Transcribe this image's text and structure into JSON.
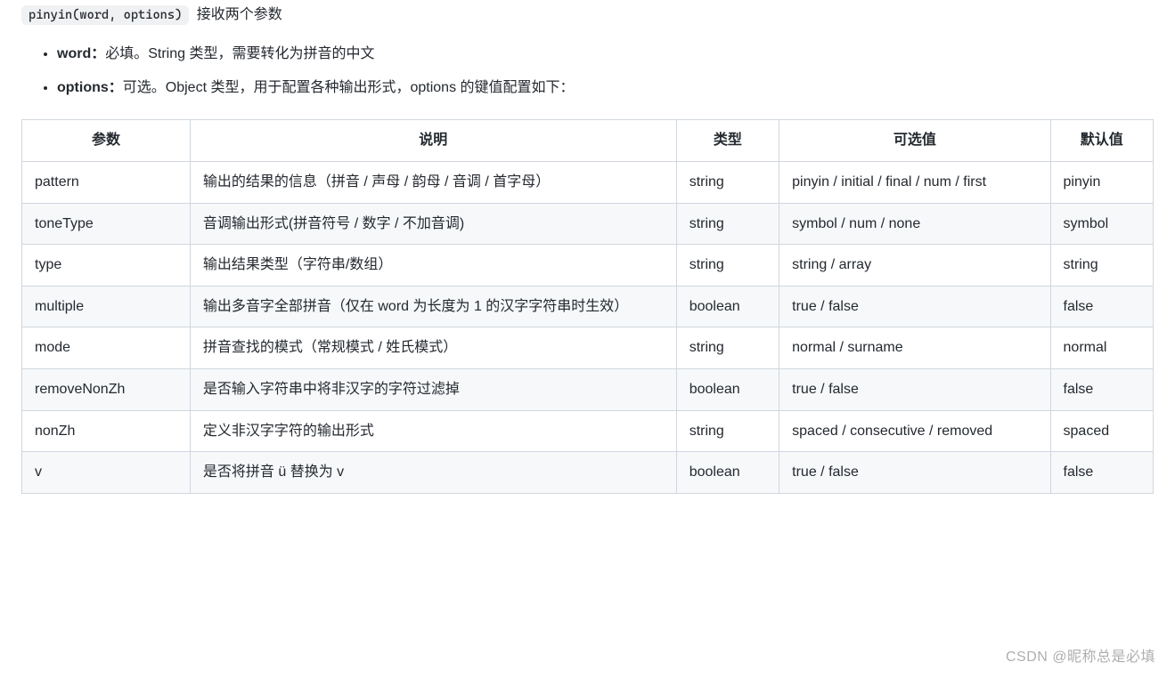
{
  "intro": {
    "code": "pinyin(word, options)",
    "label": "接收两个参数"
  },
  "args": [
    {
      "name": "word：",
      "desc": "必填。String 类型，需要转化为拼音的中文"
    },
    {
      "name": "options：",
      "desc": "可选。Object 类型，用于配置各种输出形式，options 的键值配置如下："
    }
  ],
  "table": {
    "headers": [
      "参数",
      "说明",
      "类型",
      "可选值",
      "默认值"
    ],
    "rows": [
      {
        "param": "pattern",
        "desc": "输出的结果的信息（拼音 / 声母 / 韵母 / 音调 / 首字母）",
        "type": "string",
        "options": "pinyin / initial / final / num / first",
        "default": "pinyin"
      },
      {
        "param": "toneType",
        "desc": "音调输出形式(拼音符号 / 数字 / 不加音调)",
        "type": "string",
        "options": "symbol / num / none",
        "default": "symbol"
      },
      {
        "param": "type",
        "desc": "输出结果类型（字符串/数组）",
        "type": "string",
        "options": "string / array",
        "default": "string"
      },
      {
        "param": "multiple",
        "desc": "输出多音字全部拼音（仅在 word 为长度为 1 的汉字字符串时生效）",
        "type": "boolean",
        "options": "true / false",
        "default": "false"
      },
      {
        "param": "mode",
        "desc": "拼音查找的模式（常规模式 / 姓氏模式）",
        "type": "string",
        "options": "normal / surname",
        "default": "normal"
      },
      {
        "param": "removeNonZh",
        "desc": "是否输入字符串中将非汉字的字符过滤掉",
        "type": "boolean",
        "options": "true / false",
        "default": "false"
      },
      {
        "param": "nonZh",
        "desc": "定义非汉字字符的输出形式",
        "type": "string",
        "options": "spaced / consecutive / removed",
        "default": "spaced"
      },
      {
        "param": "v",
        "desc": "是否将拼音 ü 替换为 v",
        "type": "boolean",
        "options": "true / false",
        "default": "false"
      }
    ]
  },
  "watermark": "CSDN @昵称总是必填"
}
